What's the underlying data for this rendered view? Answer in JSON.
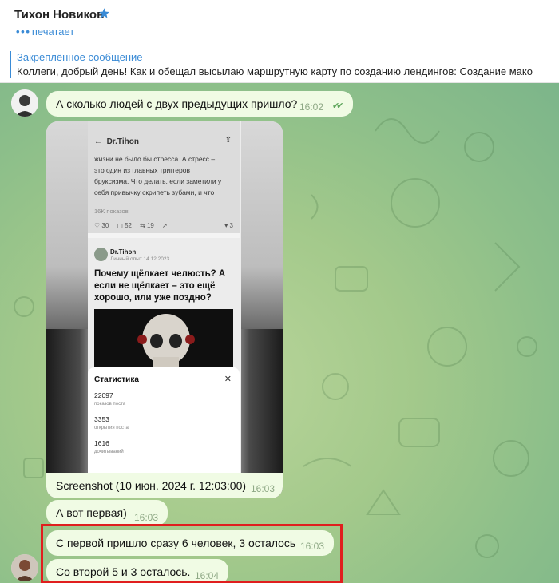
{
  "header": {
    "contact_name": "Тихон Новиков",
    "status_text": "печатает",
    "star_icon": "star-icon",
    "accent": "#3a8bd6"
  },
  "pinned": {
    "title": "Закреплённое сообщение",
    "text": "Коллеги, добрый день! Как и обещал высылаю маршрутную карту по созданию лендингов:  Создание мако"
  },
  "messages": [
    {
      "text": "А сколько людей с двух предыдущих пришло?",
      "time": "16:02",
      "read": true
    },
    {
      "text": "Screenshot (10 июн. 2024 г. 12:03:00)",
      "time": "16:03"
    },
    {
      "text": "А вот первая)",
      "time": "16:03"
    },
    {
      "text": "С первой пришло сразу 6 человек, 3 осталось",
      "time": "16:03"
    },
    {
      "text": "Со второй 5 и 3 осталось.",
      "time": "16:04"
    }
  ],
  "screenshot": {
    "app_title": "Dr.Tihon",
    "post_lines": [
      "жизни не было бы стресса. А стресс –",
      "это один из главных триггеров",
      "бруксизма. Что делать, если заметили у",
      "себя привычку скрипеть зубами, и что"
    ],
    "views_label": "16K показов",
    "reactions": {
      "likes": "30",
      "comments": "52",
      "reposts": "19",
      "bookmarks": "3"
    },
    "author": "Dr.Tihon",
    "author_meta": "Личный опыт 14.12.2023",
    "headline": [
      "Почему щёлкает челюсть? А",
      "если не щёлкает – это ещё",
      "хорошо, или уже поздно?"
    ],
    "stats_title": "Статистика",
    "stats": [
      {
        "value": "22097",
        "label": "показов поста"
      },
      {
        "value": "3353",
        "label": "открытия поста"
      },
      {
        "value": "1616",
        "label": "дочитываний"
      }
    ]
  }
}
